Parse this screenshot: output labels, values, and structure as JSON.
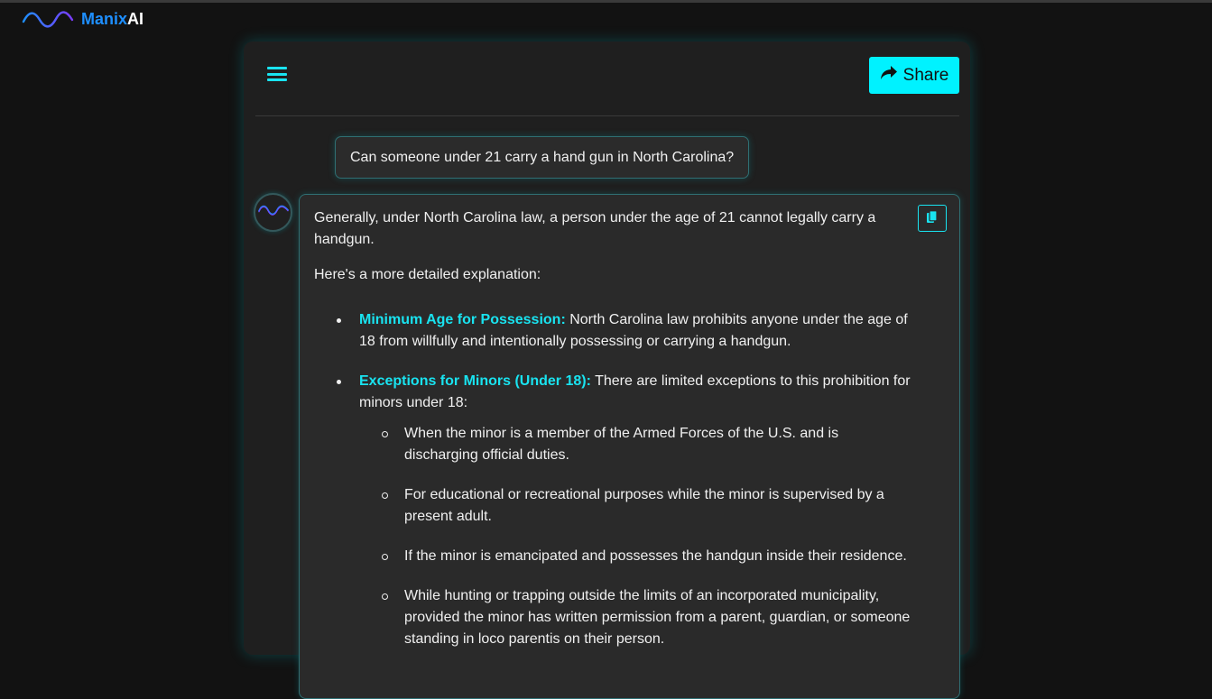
{
  "brand": {
    "name_part1": "Manix",
    "name_part2": "AI",
    "logo_icon": "wave-icon"
  },
  "header": {
    "menu_icon": "hamburger-icon",
    "share_label": "Share",
    "share_icon": "share-arrow-icon"
  },
  "conversation": {
    "user_message": "Can someone under 21 carry a hand gun in North Carolina?",
    "bot_message": {
      "intro": "Generally, under North Carolina law, a person under the age of 21 cannot legally carry a handgun.",
      "lead": "Here's a more detailed explanation:",
      "items": [
        {
          "heading": "Minimum Age for Possession:",
          "text": " North Carolina law prohibits anyone under the age of 18 from willfully and intentionally possessing or carrying a handgun."
        },
        {
          "heading": "Exceptions for Minors (Under 18):",
          "text": " There are limited exceptions to this prohibition for minors under 18:",
          "subitems": [
            "When the minor is a member of the Armed Forces of the U.S. and is discharging official duties.",
            "For educational or recreational purposes while the minor is supervised by a present adult.",
            "If the minor is emancipated and possesses the handgun inside their residence.",
            "While hunting or trapping outside the limits of an incorporated municipality, provided the minor has written permission from a parent, guardian, or someone standing in loco parentis on their person."
          ]
        }
      ]
    }
  },
  "colors": {
    "accent": "#00f2ff",
    "brand_blue": "#1e8fff",
    "background": "#121212",
    "panel": "#1f1f1f"
  }
}
